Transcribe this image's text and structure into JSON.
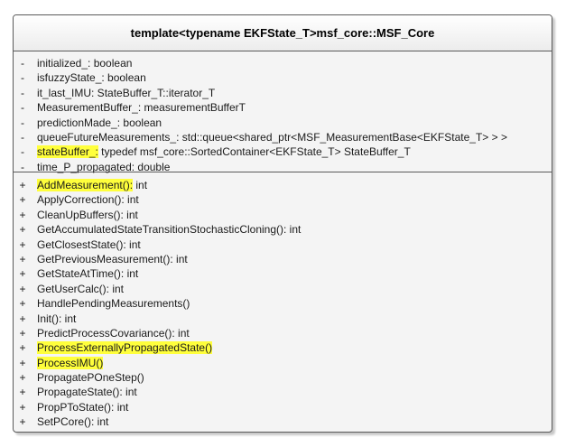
{
  "class": {
    "title": "template<typename EKFState_T>msf_core::MSF_Core"
  },
  "attributes": [
    {
      "visibility": "-",
      "text": "initialized_: boolean"
    },
    {
      "visibility": "-",
      "text": "isfuzzyState_: boolean"
    },
    {
      "visibility": "-",
      "text": "it_last_IMU: StateBuffer_T::iterator_T"
    },
    {
      "visibility": "-",
      "text": "MeasurementBuffer_: measurementBufferT"
    },
    {
      "visibility": "-",
      "text": "predictionMade_: boolean"
    },
    {
      "visibility": "-",
      "text": "queueFutureMeasurements_: std::queue<shared_ptr<MSF_MeasurementBase<EKFState_T> > >"
    },
    {
      "visibility": "-",
      "text": "stateBuffer_: typedef msf_core::SortedContainer<EKFState_T> StateBuffer_T",
      "highlight": "stateBuffer_:"
    },
    {
      "visibility": "-",
      "text": "time_P_propagated: double"
    }
  ],
  "operations": [
    {
      "visibility": "+",
      "text": "AddMeasurement(): int",
      "highlight": "AddMeasurement():"
    },
    {
      "visibility": "+",
      "text": "ApplyCorrection(): int"
    },
    {
      "visibility": "+",
      "text": "CleanUpBuffers(): int"
    },
    {
      "visibility": "+",
      "text": "GetAccumulatedStateTransitionStochasticCloning(): int"
    },
    {
      "visibility": "+",
      "text": "GetClosestState(): int"
    },
    {
      "visibility": "+",
      "text": "GetPreviousMeasurement(): int"
    },
    {
      "visibility": "+",
      "text": "GetStateAtTime(): int"
    },
    {
      "visibility": "+",
      "text": "GetUserCalc(): int"
    },
    {
      "visibility": "+",
      "text": "HandlePendingMeasurements()"
    },
    {
      "visibility": "+",
      "text": "Init(): int"
    },
    {
      "visibility": "+",
      "text": "PredictProcessCovariance(): int"
    },
    {
      "visibility": "+",
      "text": "ProcessExternallyPropagatedState()",
      "highlight": "ProcessExternallyPropagatedState()"
    },
    {
      "visibility": "+",
      "text": "ProcessIMU()",
      "highlight": "ProcessIMU()"
    },
    {
      "visibility": "+",
      "text": "PropagatePOneStep()"
    },
    {
      "visibility": "+",
      "text": "PropagateState(): int"
    },
    {
      "visibility": "+",
      "text": "PropPToState(): int"
    },
    {
      "visibility": "+",
      "text": "SetPCore(): int"
    }
  ],
  "colors": {
    "highlight": "#ffff3c",
    "border": "#5a5a5a",
    "background": "#f4f4f4"
  }
}
